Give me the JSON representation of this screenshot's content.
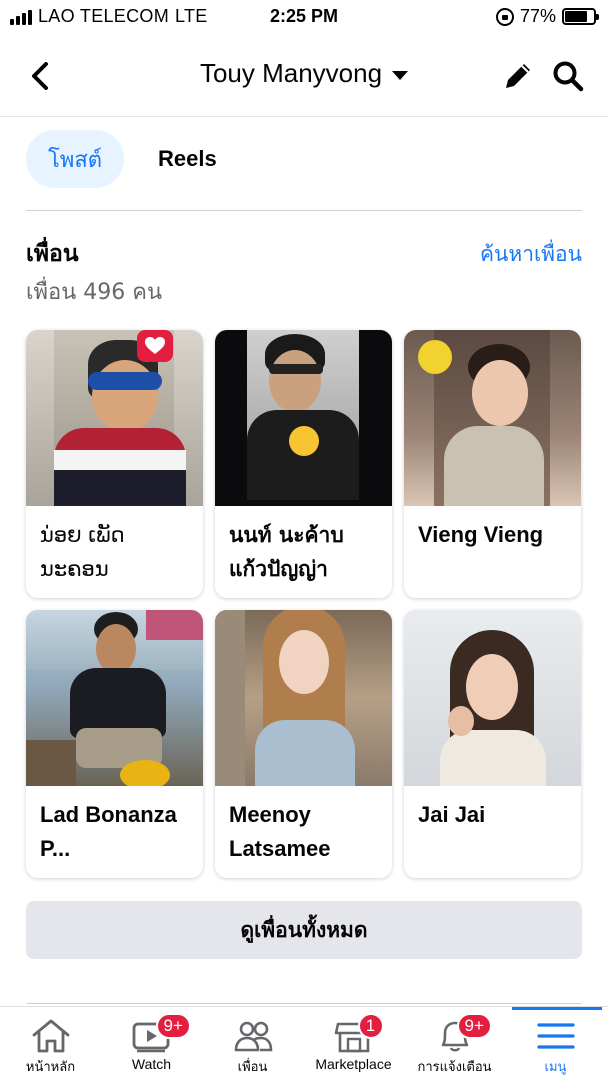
{
  "status_bar": {
    "carrier": "LAO TELECOM",
    "network": "LTE",
    "time": "2:25 PM",
    "battery_percent": "77%",
    "battery_level": 0.77
  },
  "header": {
    "profile_name": "Touy Manyvong",
    "back_icon": "chevron-left-icon",
    "edit_icon": "pencil-icon",
    "search_icon": "search-icon"
  },
  "tabs": [
    {
      "label": "โพสต์",
      "active": true
    },
    {
      "label": "Reels",
      "active": false
    }
  ],
  "friends": {
    "title": "เพื่อน",
    "count_text": "เพื่อน 496 คน",
    "find_link": "ค้นหาเพื่อน",
    "cards": [
      {
        "name": "ນ່ອຍ ເພັດ ນະຄອນ"
      },
      {
        "name": "นนท์ นะค้าบ แก้วปัญญ่า"
      },
      {
        "name": "Vieng Vieng"
      },
      {
        "name": "Lad Bonanza P..."
      },
      {
        "name": "Meenoy Latsamee"
      },
      {
        "name": "Jai Jai"
      }
    ],
    "see_all": "ดูเพื่อนทั้งหมด"
  },
  "bottom_nav": [
    {
      "label": "หน้าหลัก",
      "icon": "home-icon",
      "badge": ""
    },
    {
      "label": "Watch",
      "icon": "watch-video-icon",
      "badge": "9+"
    },
    {
      "label": "เพื่อน",
      "icon": "friends-icon",
      "badge": ""
    },
    {
      "label": "Marketplace",
      "icon": "marketplace-store-icon",
      "badge": "1"
    },
    {
      "label": "การแจ้งเตือน",
      "icon": "bell-icon",
      "badge": "9+"
    },
    {
      "label": "เมนู",
      "icon": "menu-hamburger-icon",
      "badge": "",
      "active": true
    }
  ],
  "colors": {
    "accent": "#1877f2",
    "badge": "#e41e3f",
    "secondary_text": "#65676b",
    "button_bg": "#e4e6eb"
  }
}
